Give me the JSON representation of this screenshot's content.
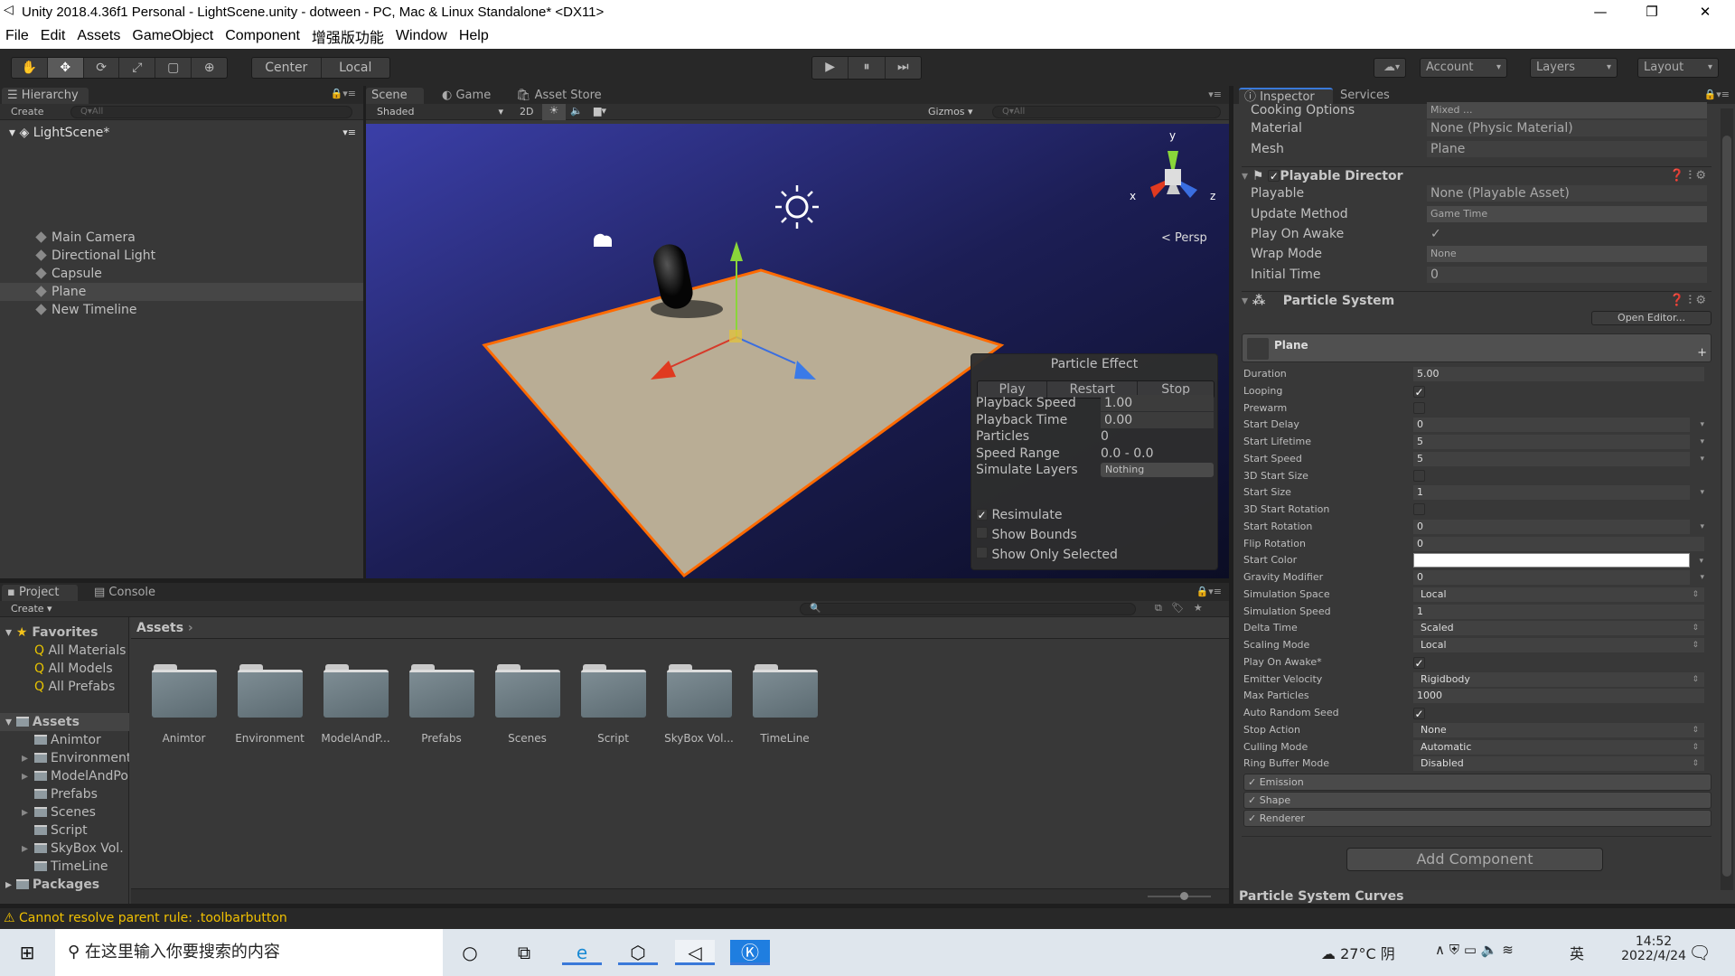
{
  "window": {
    "title": "Unity 2018.4.36f1 Personal - LightScene.unity - dotween - PC, Mac & Linux Standalone* <DX11>",
    "minimize": "—",
    "maximize": "❐",
    "close": "✕"
  },
  "menu": [
    "File",
    "Edit",
    "Assets",
    "GameObject",
    "Component",
    "增强版功能",
    "Window",
    "Help"
  ],
  "toolbar": {
    "tools": [
      "hand-tool",
      "move-tool",
      "rotate-tool",
      "scale-tool",
      "rect-tool",
      "transform-tool"
    ],
    "tool_glyphs": [
      "✋",
      "✥",
      "⟳",
      "⤢",
      "▢",
      "⊕"
    ],
    "active_tool": "move-tool",
    "pivot": "Center",
    "space": "Local",
    "play": "▶",
    "pause": "⏸",
    "step": "⏭",
    "cloud": "☁",
    "account": "Account",
    "layers": "Layers",
    "layout": "Layout"
  },
  "hierarchy": {
    "tab": "Hierarchy",
    "create": "Create",
    "search_placeholder": "Q▾All",
    "scene": "LightScene*",
    "items": [
      "Main Camera",
      "Directional Light",
      "Capsule",
      "Plane",
      "New Timeline"
    ],
    "selected": "Plane"
  },
  "scene": {
    "tabs": [
      "Scene",
      "Game",
      "Asset Store"
    ],
    "shading": "Shaded",
    "mode2d": "2D",
    "gizmos": "Gizmos",
    "search_placeholder": "Q▾All",
    "persp": "Persp",
    "axes": {
      "x": "x",
      "y": "y",
      "z": "z"
    }
  },
  "particle_effect": {
    "title": "Particle Effect",
    "play": "Play",
    "restart": "Restart",
    "stop": "Stop",
    "rows": [
      {
        "label": "Playback Speed",
        "value": "1.00"
      },
      {
        "label": "Playback Time",
        "value": "0.00"
      },
      {
        "label": "Particles",
        "value": "0"
      },
      {
        "label": "Speed Range",
        "value": "0.0 - 0.0"
      },
      {
        "label": "Simulate Layers",
        "value": "Nothing"
      }
    ],
    "checks": [
      {
        "label": "Resimulate",
        "checked": true
      },
      {
        "label": "Show Bounds",
        "checked": false
      },
      {
        "label": "Show Only Selected",
        "checked": false
      }
    ]
  },
  "inspector": {
    "tabs": [
      "Inspector",
      "Services"
    ],
    "collider_rows": [
      {
        "label": "Cooking Options",
        "value": "Mixed ..."
      },
      {
        "label": "Material",
        "value": "None (Physic Material)"
      },
      {
        "label": "Mesh",
        "value": "Plane"
      }
    ],
    "playable_director": {
      "title": "Playable Director",
      "enabled": true,
      "rows": [
        {
          "label": "Playable",
          "value": "None (Playable Asset)"
        },
        {
          "label": "Update Method",
          "value": "Game Time"
        },
        {
          "label": "Play On Awake",
          "value": "✓"
        },
        {
          "label": "Wrap Mode",
          "value": "None"
        },
        {
          "label": "Initial Time",
          "value": "0"
        }
      ]
    },
    "particle_system": {
      "title": "Particle System",
      "open_editor": "Open Editor...",
      "module_title": "Plane",
      "add": "+",
      "rows": [
        {
          "label": "Duration",
          "value": "5.00",
          "kind": "text"
        },
        {
          "label": "Looping",
          "value": "✓",
          "kind": "check"
        },
        {
          "label": "Prewarm",
          "value": "",
          "kind": "check"
        },
        {
          "label": "Start Delay",
          "value": "0",
          "kind": "curve"
        },
        {
          "label": "Start Lifetime",
          "value": "5",
          "kind": "curve"
        },
        {
          "label": "Start Speed",
          "value": "5",
          "kind": "curve"
        },
        {
          "label": "3D Start Size",
          "value": "",
          "kind": "check"
        },
        {
          "label": "Start Size",
          "value": "1",
          "kind": "curve"
        },
        {
          "label": "3D Start Rotation",
          "value": "",
          "kind": "check"
        },
        {
          "label": "Start Rotation",
          "value": "0",
          "kind": "curve"
        },
        {
          "label": "Flip Rotation",
          "value": "0",
          "kind": "text"
        },
        {
          "label": "Start Color",
          "value": "",
          "kind": "color"
        },
        {
          "label": "Gravity Modifier",
          "value": "0",
          "kind": "curve"
        },
        {
          "label": "Simulation Space",
          "value": "Local",
          "kind": "dropdown"
        },
        {
          "label": "Simulation Speed",
          "value": "1",
          "kind": "text"
        },
        {
          "label": "Delta Time",
          "value": "Scaled",
          "kind": "dropdown"
        },
        {
          "label": "Scaling Mode",
          "value": "Local",
          "kind": "dropdown"
        },
        {
          "label": "Play On Awake*",
          "value": "✓",
          "kind": "check"
        },
        {
          "label": "Emitter Velocity",
          "value": "Rigidbody",
          "kind": "dropdown"
        },
        {
          "label": "Max Particles",
          "value": "1000",
          "kind": "text"
        },
        {
          "label": "Auto Random Seed",
          "value": "✓",
          "kind": "check"
        },
        {
          "label": "Stop Action",
          "value": "None",
          "kind": "dropdown"
        },
        {
          "label": "Culling Mode",
          "value": "Automatic",
          "kind": "dropdown"
        },
        {
          "label": "Ring Buffer Mode",
          "value": "Disabled",
          "kind": "dropdown"
        }
      ],
      "modules": [
        "Emission",
        "Shape",
        "Renderer"
      ]
    },
    "add_component": "Add Component",
    "curves": "Particle System Curves"
  },
  "project": {
    "tabs": [
      "Project",
      "Console"
    ],
    "create": "Create",
    "favorites": "Favorites",
    "favorite_items": [
      "All Materials",
      "All Models",
      "All Prefabs"
    ],
    "assets": "Assets",
    "tree": [
      {
        "name": "Animtor",
        "expandable": false
      },
      {
        "name": "Environment",
        "expandable": true
      },
      {
        "name": "ModelAndPo",
        "expandable": true
      },
      {
        "name": "Prefabs",
        "expandable": false
      },
      {
        "name": "Scenes",
        "expandable": true
      },
      {
        "name": "Script",
        "expandable": false
      },
      {
        "name": "SkyBox Vol.",
        "expandable": true
      },
      {
        "name": "TimeLine",
        "expandable": false
      }
    ],
    "packages": "Packages",
    "breadcrumb": "Assets",
    "folders": [
      "Animtor",
      "Environment",
      "ModelAndP...",
      "Prefabs",
      "Scenes",
      "Script",
      "SkyBox Vol...",
      "TimeLine"
    ]
  },
  "status": {
    "message": "Cannot resolve parent rule: .toolbarbutton",
    "color": "#f0c000"
  },
  "taskbar": {
    "search_placeholder": "在这里输入你要搜索的内容",
    "weather": "27°C 阴",
    "ime": "英",
    "time": "14:52",
    "date": "2022/4/24"
  },
  "colors": {
    "selection_outline": "#ff6a00",
    "inspector_tab_accent": "#3a79d9"
  }
}
